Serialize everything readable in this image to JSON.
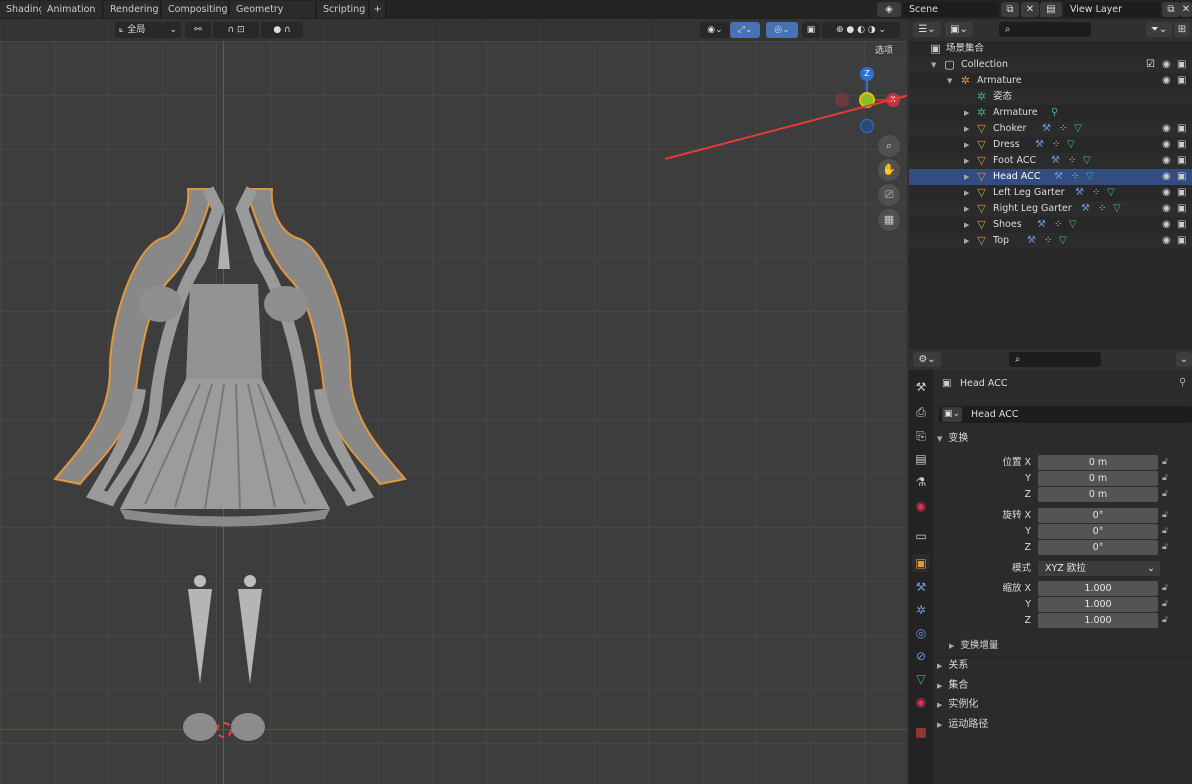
{
  "topbar": {
    "workspace_tabs": [
      "Shading",
      "Animation",
      "Rendering",
      "Compositing",
      "Geometry Nodes",
      "Scripting"
    ],
    "add_tab": "+",
    "scene": "Scene",
    "view_layer": "View Layer"
  },
  "viewport": {
    "pivot_label": "全局",
    "options_label": "选项",
    "gizmo": {
      "z": "Z",
      "x": "X"
    },
    "accent_x_axis": "#c0343e",
    "accent_y_axis": "#88bf26",
    "accent_z_axis": "#2a71d1"
  },
  "outliner": {
    "scene_collection": "场景集合",
    "rows": [
      {
        "label": "Collection",
        "indent": 1,
        "icon": "collection-icon"
      },
      {
        "label": "Armature",
        "indent": 2,
        "icon": "armature-object-icon"
      },
      {
        "label": "姿态",
        "indent": 3,
        "icon": "pose-icon"
      },
      {
        "label": "Armature",
        "indent": 3,
        "icon": "armature-data-icon"
      },
      {
        "label": "Choker",
        "indent": 3,
        "icon": "mesh-icon"
      },
      {
        "label": "Dress",
        "indent": 3,
        "icon": "mesh-icon"
      },
      {
        "label": "Foot ACC",
        "indent": 3,
        "icon": "mesh-icon"
      },
      {
        "label": "Head ACC",
        "indent": 3,
        "icon": "mesh-icon"
      },
      {
        "label": "Left Leg Garter",
        "indent": 3,
        "icon": "mesh-icon"
      },
      {
        "label": "Right Leg Garter",
        "indent": 3,
        "icon": "mesh-icon"
      },
      {
        "label": "Shoes",
        "indent": 3,
        "icon": "mesh-icon"
      },
      {
        "label": "Top",
        "indent": 3,
        "icon": "mesh-icon"
      }
    ],
    "selected": "Head ACC"
  },
  "properties": {
    "object_name": "Head ACC",
    "object_field": "Head ACC",
    "transform_title": "变换",
    "location_label": "位置 X",
    "rotation_label": "旋转 X",
    "mode_label": "模式",
    "scale_label": "缩放 X",
    "y_label": "Y",
    "z_label": "Z",
    "location": [
      "0 m",
      "0 m",
      "0 m"
    ],
    "rotation": [
      "0°",
      "0°",
      "0°"
    ],
    "rotation_mode": "XYZ 欧拉",
    "scale": [
      "1.000",
      "1.000",
      "1.000"
    ],
    "delta_transform": "变换增量",
    "sections": [
      "关系",
      "集合",
      "实例化",
      "运动路径"
    ]
  }
}
